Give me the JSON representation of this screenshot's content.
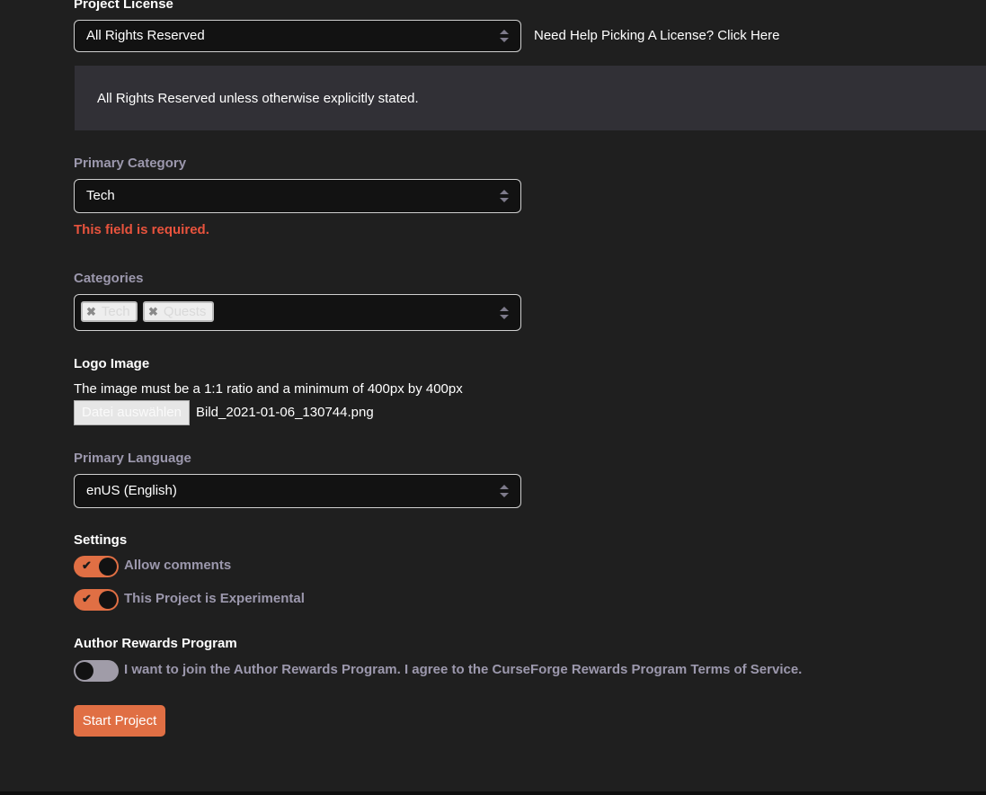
{
  "license": {
    "label": "Project License",
    "selected": "All Rights Reserved",
    "help_link": "Need Help Picking A License? Click Here",
    "description": "All Rights Reserved unless otherwise explicitly stated."
  },
  "primary_category": {
    "label": "Primary Category",
    "selected": "Tech",
    "error": "This field is required."
  },
  "categories": {
    "label": "Categories",
    "tags": [
      {
        "label": "Tech",
        "remove_icon": "✖"
      },
      {
        "label": "Quests",
        "remove_icon": "✖"
      }
    ]
  },
  "logo": {
    "label": "Logo Image",
    "hint": "The image must be a 1:1 ratio and a minimum of 400px by 400px",
    "choose_button": "Datei auswählen",
    "file_name": "Bild_2021-01-06_130744.png"
  },
  "primary_language": {
    "label": "Primary Language",
    "selected": "enUS (English)"
  },
  "settings": {
    "label": "Settings",
    "toggles": [
      {
        "label": "Allow comments",
        "checked": true,
        "check_icon": "✔"
      },
      {
        "label": "This Project is Experimental",
        "checked": true,
        "check_icon": "✔"
      }
    ]
  },
  "rewards": {
    "label": "Author Rewards Program",
    "toggle_label": "I want to join the Author Rewards Program. I agree to the CurseForge Rewards Program Terms of Service.",
    "checked": false
  },
  "submit": {
    "label": "Start Project"
  },
  "colors": {
    "accent": "#e06f44",
    "error": "#e8533d",
    "muted_label": "#9c98ad",
    "background": "#1f1f1f"
  }
}
